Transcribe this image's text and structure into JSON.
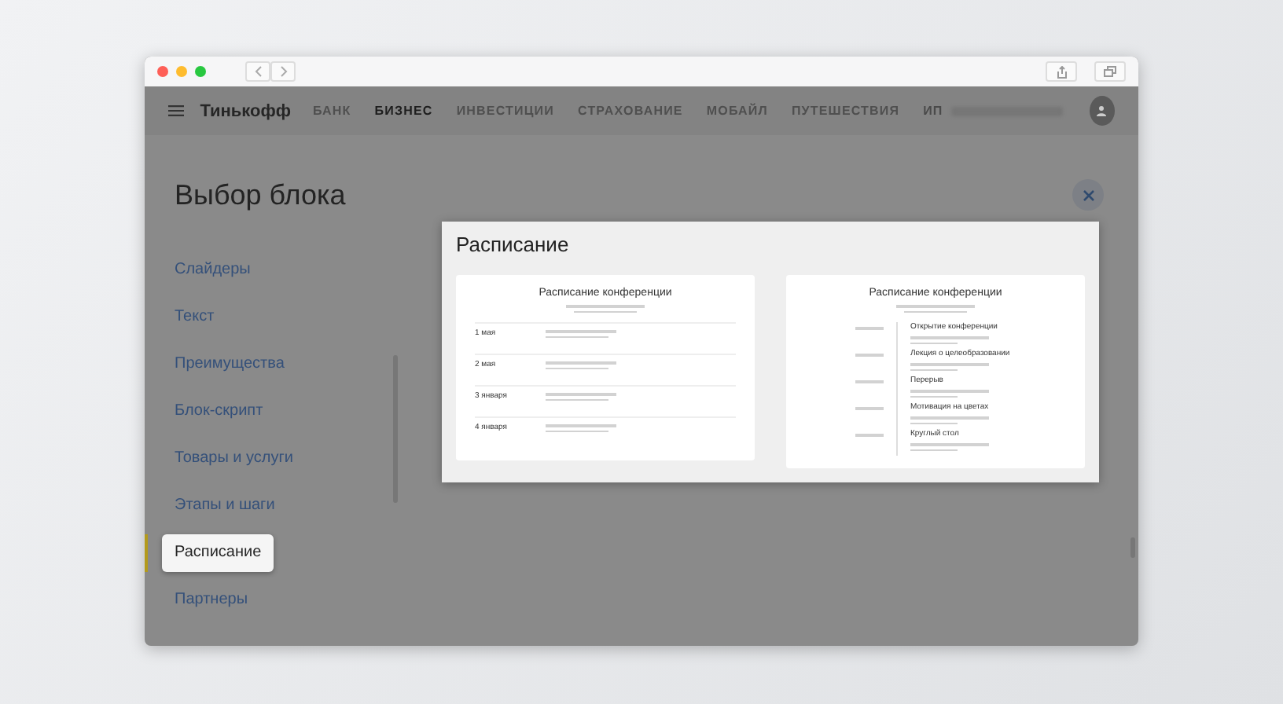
{
  "nav": {
    "brand": "Тинькофф",
    "links": [
      {
        "label": "БАНК",
        "selected": false
      },
      {
        "label": "БИЗНЕС",
        "selected": true
      },
      {
        "label": "ИНВЕСТИЦИИ",
        "selected": false
      },
      {
        "label": "СТРАХОВАНИЕ",
        "selected": false
      },
      {
        "label": "МОБАЙЛ",
        "selected": false
      },
      {
        "label": "ПУТЕШЕСТВИЯ",
        "selected": false
      }
    ],
    "user": "ИП"
  },
  "modal": {
    "title": "Выбор блока",
    "sidebar": {
      "items": [
        {
          "label": "Слайдеры",
          "selected": false
        },
        {
          "label": "Текст",
          "selected": false
        },
        {
          "label": "Преимущества",
          "selected": false
        },
        {
          "label": "Блок-скрипт",
          "selected": false
        },
        {
          "label": "Товары и услуги",
          "selected": false
        },
        {
          "label": "Этапы и шаги",
          "selected": false
        },
        {
          "label": "Расписание",
          "selected": true
        },
        {
          "label": "Партнеры",
          "selected": false
        }
      ]
    },
    "preview": {
      "title": "Расписание",
      "cards": [
        {
          "kind": "table",
          "title": "Расписание конференции",
          "rows": [
            "1 мая",
            "2 мая",
            "3 января",
            "4 января"
          ]
        },
        {
          "kind": "timeline",
          "title": "Расписание конференции",
          "rows": [
            "Открытие конференции",
            "Лекция о целеобразовании",
            "Перерыв",
            "Мотивация на цветах",
            "Круглый стол"
          ]
        }
      ]
    }
  }
}
